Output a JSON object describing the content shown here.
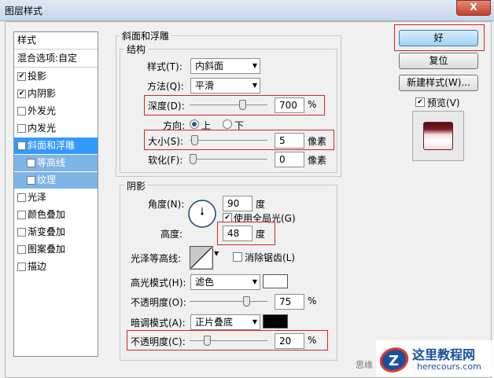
{
  "window": {
    "title": "图层样式",
    "close": "X"
  },
  "styles_list": {
    "header": "样式",
    "blend": "混合选项:自定",
    "items": [
      {
        "label": "投影",
        "checked": true
      },
      {
        "label": "内阴影",
        "checked": true
      },
      {
        "label": "外发光",
        "checked": false
      },
      {
        "label": "内发光",
        "checked": false
      },
      {
        "label": "斜面和浮雕",
        "checked": true,
        "selected": true
      },
      {
        "label": "等高线",
        "checked": false,
        "sub": true
      },
      {
        "label": "纹理",
        "checked": false,
        "sub": true
      },
      {
        "label": "光泽",
        "checked": false
      },
      {
        "label": "颜色叠加",
        "checked": false
      },
      {
        "label": "渐变叠加",
        "checked": false
      },
      {
        "label": "图案叠加",
        "checked": false
      },
      {
        "label": "描边",
        "checked": false
      }
    ]
  },
  "bevel": {
    "group_title": "斜面和浮雕",
    "structure_title": "结构",
    "style_label": "样式(T):",
    "style_value": "内斜面",
    "method_label": "方法(Q):",
    "method_value": "平滑",
    "depth_label": "深度(D):",
    "depth_value": "700",
    "depth_unit": "%",
    "depth_fraction": 0.7,
    "direction_label": "方向:",
    "direction_up": "上",
    "direction_down": "下",
    "size_label": "大小(S):",
    "size_value": "5",
    "size_unit": "像素",
    "size_fraction": 0.02,
    "soften_label": "软化(F):",
    "soften_value": "0",
    "soften_unit": "像素",
    "soften_fraction": 0.0
  },
  "shading": {
    "group_title": "阴影",
    "angle_label": "角度(N):",
    "angle_value": "90",
    "angle_unit": "度",
    "global_light_label": "使用全局光(G)",
    "altitude_label": "高度:",
    "altitude_value": "48",
    "altitude_unit": "度",
    "gloss_label": "光泽等高线:",
    "antialias_label": "消除锯齿(L)",
    "highlight_mode_label": "高光模式(H):",
    "highlight_mode_value": "滤色",
    "highlight_color": "#ffffff",
    "highlight_opacity_label": "不透明度(O):",
    "highlight_opacity_value": "75",
    "highlight_opacity_fraction": 0.75,
    "shadow_mode_label": "暗调模式(A):",
    "shadow_mode_value": "正片叠底",
    "shadow_color": "#000000",
    "shadow_opacity_label": "不透明度(C):",
    "shadow_opacity_value": "20",
    "shadow_opacity_fraction": 0.2,
    "percent": "%"
  },
  "buttons": {
    "ok": "好",
    "reset": "复位",
    "new_style": "新建样式(W)...",
    "preview_label": "预览(V)"
  },
  "watermark": {
    "partial_text": "思缘",
    "site_name": "这里教程网",
    "site_url": "herecours.com",
    "logo_letter": "Z"
  },
  "colors": {
    "accent_selected": "#3399ff",
    "highlight_box": "#e0201f"
  }
}
